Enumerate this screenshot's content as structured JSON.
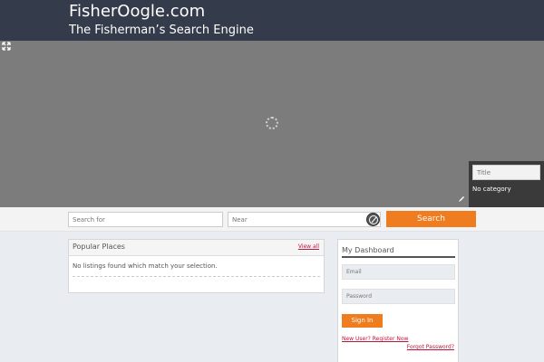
{
  "header": {
    "title": "FisherOogle.com",
    "tagline": "The Fisherman’s Search Engine"
  },
  "map": {
    "title_placeholder": "Title",
    "no_category": "No category"
  },
  "search": {
    "search_for_placeholder": "Search for",
    "near_placeholder": "Near",
    "button_label": "Search"
  },
  "popular": {
    "title": "Popular Places",
    "view_all": "View all",
    "empty_text": "No listings found which match your selection."
  },
  "dashboard": {
    "title": "My Dashboard",
    "email_placeholder": "Email",
    "password_placeholder": "Password",
    "signin_label": "Sign In",
    "register_link": "New User? Register Now",
    "forgot_link": "Forgot Password?"
  },
  "colors": {
    "header_bg": "#343b4a",
    "accent_orange": "#f07c20",
    "link_red": "#c0143c"
  },
  "icons": [
    "expand-icon",
    "loading-spinner-icon",
    "pencil-icon",
    "compass-icon"
  ]
}
